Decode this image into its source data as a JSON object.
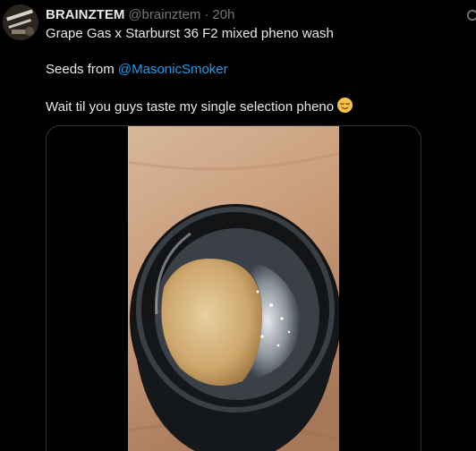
{
  "author": {
    "name": "BRAINZTEM",
    "handle": "@brainztem",
    "separator": "·",
    "time": "20h"
  },
  "tweet": {
    "line1": "Grape Gas x Starburst 36 F2 mixed pheno wash",
    "line2_prefix": "Seeds from ",
    "mention": "@MasonicSmoker",
    "line3": "Wait til you guys taste my single selection pheno",
    "emoji": "relieved-face-icon"
  },
  "icons": {
    "more": "more-icon",
    "avatar": "avatar-image",
    "media": "jar-photo"
  },
  "colors": {
    "background": "#000000",
    "text": "#e7e9ea",
    "secondary": "#71767b",
    "link": "#1d9bf0",
    "border": "#2f3336"
  }
}
